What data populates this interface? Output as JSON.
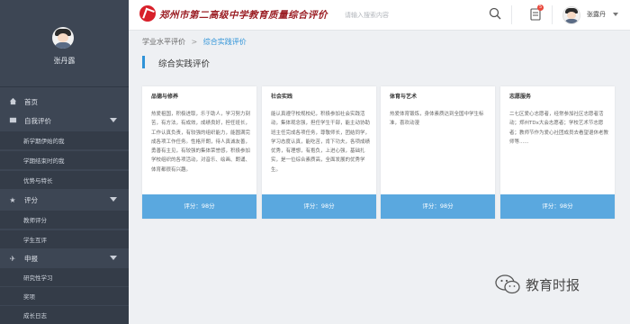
{
  "sidebar": {
    "profile_name": "张丹露",
    "items": [
      {
        "label": "首页",
        "icon": "home-icon"
      },
      {
        "label": "自我评价",
        "icon": "message-icon"
      },
      {
        "label": "新学期伊始的我"
      },
      {
        "label": "学期结束时的我"
      },
      {
        "label": "优势与特长"
      },
      {
        "label": "评分",
        "icon": "star-icon"
      },
      {
        "label": "教师评分"
      },
      {
        "label": "学生互评"
      },
      {
        "label": "申报",
        "icon": "plane-icon"
      },
      {
        "label": "研究性学习"
      },
      {
        "label": "奖项"
      },
      {
        "label": "成长日志"
      }
    ]
  },
  "header": {
    "site_title": "郑州市第二高级中学教育质量综合评价",
    "search_placeholder": "请输入搜索内容",
    "notification_count": "5",
    "user_name": "张露丹"
  },
  "breadcrumb": {
    "parent": "学业水平评价",
    "separator": ">",
    "current": "综合实践评价"
  },
  "page_title": "综合实践评价",
  "cards": [
    {
      "title": "品德与修养",
      "text": "热爱祖国，积极进取，乐于助人，学习努力刻苦，有方法，有成效，成绩良好，担任班长，工作认真负责，有较强的组织能力，能圆满完成各项工作任务。性格开朗，待人真诚友善，勇善有主见，有较强的集体荣誉感，积极参加学校组织的各项活动，对音乐、绘画、朗诵、体育都很有兴趣。",
      "score": "评分：98分"
    },
    {
      "title": "社会实践",
      "text": "能认真遵守校规校纪，积极参加社会实践活动，集体观念强，担任学生干部，能主动协助班主任完成各项任务，尊敬师长，团结同学，学习态度认真，能吃苦，肯下功夫，各项成绩优秀，有理想，有抱负，上进心强，基础扎实，是一位综合素质高，全面发展的优秀学生。",
      "score": "评分：98分"
    },
    {
      "title": "体育与艺术",
      "text": "热爱体育锻炼，身体素质达到全国中学生标准，喜欢动漫",
      "score": "评分：98分"
    },
    {
      "title": "志愿服务",
      "text": "二七区爱心志愿者，经常参加社区志愿者活动；郑州TDx大会志愿者；学校艺术节志愿者；教师节作为爱心社团成员去看望退休老教师等......",
      "score": "评分：98分"
    }
  ],
  "watermark": "教育时报",
  "colors": {
    "sidebar_bg": "#3d4654",
    "accent": "#2f93d8",
    "card_footer": "#5aa8df",
    "brand_red": "#9b1f25",
    "badge": "#e8473b"
  }
}
